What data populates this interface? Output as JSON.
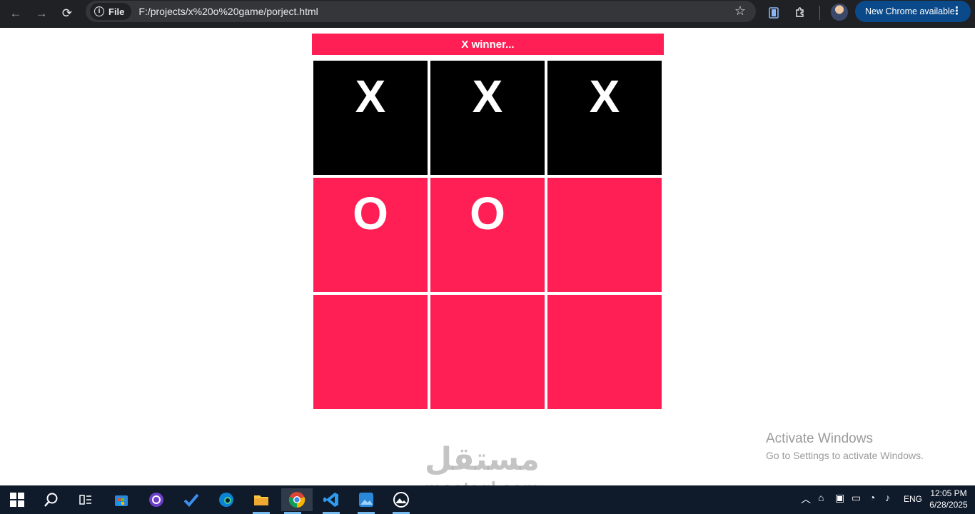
{
  "browser": {
    "back_icon": "←",
    "forward_icon": "→",
    "reload_icon": "⟳",
    "site_chip_label": "File",
    "url": "F:/projects/x%20o%20game/porject.html",
    "update_label": "New Chrome available",
    "update_menu_icon": "⋮"
  },
  "game": {
    "status": "X winner...",
    "cells": [
      "X",
      "X",
      "X",
      "O",
      "O",
      "",
      "",
      "",
      ""
    ],
    "winning_cells": [
      0,
      1,
      2
    ],
    "colors": {
      "cell": "#ff1f55",
      "win": "#000000",
      "mark": "#ffffff"
    }
  },
  "watermark": {
    "activate_title": "Activate Windows",
    "activate_sub": "Go to Settings to activate Windows.",
    "mostaql_arabic": "مستقل",
    "mostaql_latin": "mostaql.com"
  },
  "taskbar": {
    "language": "ENG",
    "time": "12:05 PM",
    "date": "6/28/2025"
  }
}
